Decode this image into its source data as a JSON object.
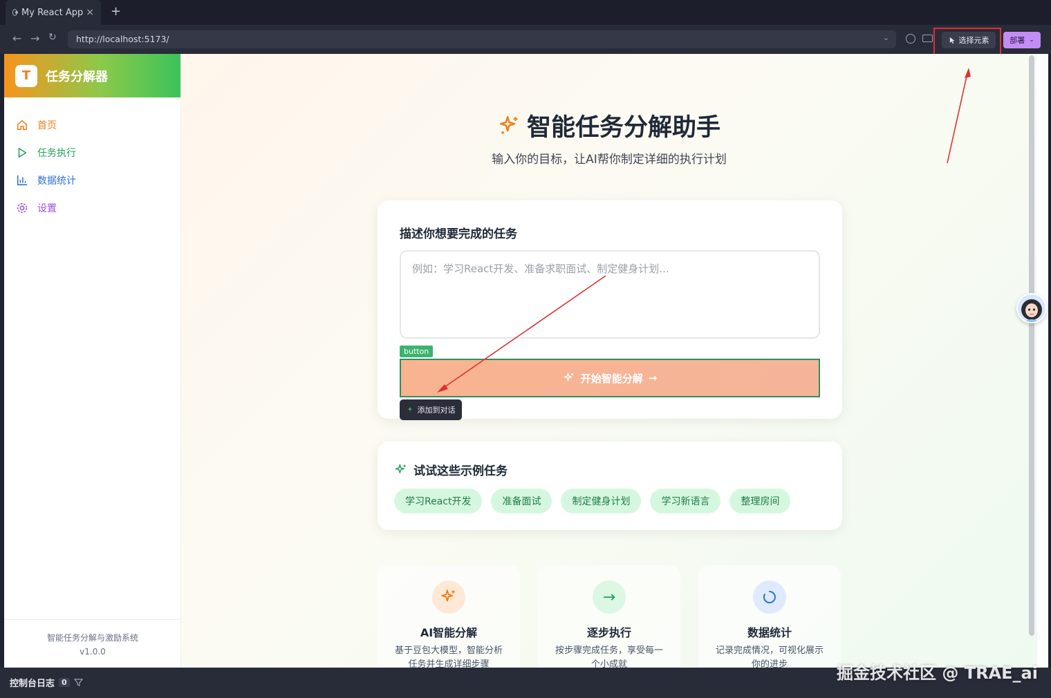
{
  "browser": {
    "tab_title": "My React App",
    "tab_close": "×",
    "new_tab": "+",
    "url": "http://localhost:5173/",
    "select_element_label": "选择元素",
    "deploy_label": "部署"
  },
  "sidebar": {
    "brand_logo": "T",
    "brand_name": "任务分解器",
    "items": [
      {
        "label": "首页",
        "icon": "home-icon",
        "color": "#f07e1a"
      },
      {
        "label": "任务执行",
        "icon": "play-icon",
        "color": "#23a15a"
      },
      {
        "label": "数据统计",
        "icon": "bar-chart-icon",
        "color": "#2c6fd6"
      },
      {
        "label": "设置",
        "icon": "gear-icon",
        "color": "#9b4ed8"
      }
    ],
    "footer_line1": "智能任务分解与激励系统",
    "footer_line2": "v1.0.0"
  },
  "hero": {
    "title": "智能任务分解助手",
    "subtitle": "输入你的目标，让AI帮你制定详细的执行计划"
  },
  "task_card": {
    "title": "描述你想要完成的任务",
    "placeholder": "例如：学习React开发、准备求职面试、制定健身计划...",
    "element_tag": "button",
    "start_button": "开始智能分解",
    "add_to_chat": "添加到对话"
  },
  "examples": {
    "title": "试试这些示例任务",
    "chips": [
      "学习React开发",
      "准备面试",
      "制定健身计划",
      "学习新语言",
      "整理房间"
    ]
  },
  "features": [
    {
      "title": "AI智能分解",
      "desc": "基于豆包大模型，智能分析任务并生成详细步骤",
      "icon": "sparkle-icon",
      "bg": "#ffe9d6"
    },
    {
      "title": "逐步执行",
      "desc": "按步骤完成任务，享受每一个小成就",
      "icon": "arrow-right-icon",
      "bg": "#dcf7e3"
    },
    {
      "title": "数据统计",
      "desc": "记录完成情况，可视化展示你的进步",
      "icon": "refresh-icon",
      "bg": "#dfeaff"
    }
  ],
  "statusbar": {
    "console_label": "控制台日志",
    "console_count": "0"
  },
  "watermark": "掘金技术社区 @ TRAE_ai",
  "colors": {
    "accent_orange": "#f07e1a",
    "accent_green": "#3cc25a",
    "highlight_red": "#e03030"
  }
}
